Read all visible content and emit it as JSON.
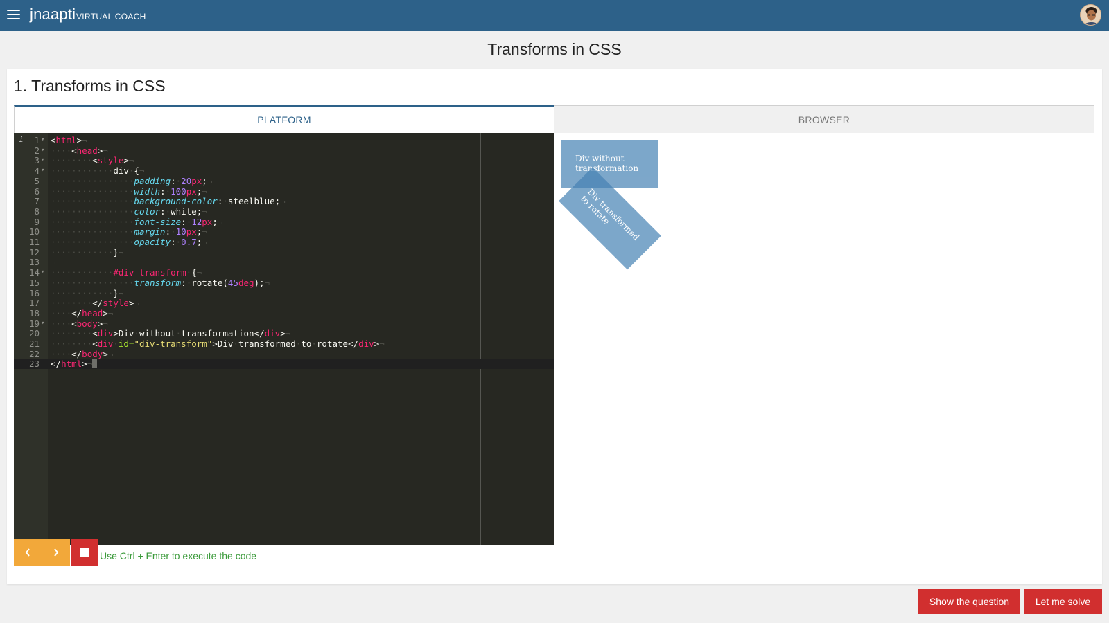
{
  "header": {
    "menu_icon": "hamburger-icon",
    "brand": "jnaapti",
    "brand_sub": "VIRTUAL COACH",
    "avatar_icon": "user-avatar"
  },
  "page_title": "Transforms in CSS",
  "card": {
    "title": "1. Transforms in CSS",
    "tabs": [
      {
        "label": "PLATFORM",
        "active": true
      },
      {
        "label": "BROWSER",
        "active": false
      }
    ]
  },
  "editor": {
    "lines": [
      "<html>",
      "    <head>",
      "        <style>",
      "            div {",
      "                padding: 20px;",
      "                width: 100px;",
      "                background-color: steelblue;",
      "                color: white;",
      "                font-size: 12px;",
      "                margin: 10px;",
      "                opacity: 0.7;",
      "            }",
      "",
      "            #div-transform {",
      "                transform: rotate(45deg);",
      "            }",
      "        </style>",
      "    </head>",
      "    <body>",
      "        <div>Div without transformation</div>",
      "        <div id=\"div-transform\">Div transformed to rotate</div>",
      "    </body>",
      "</html>"
    ],
    "folded_lines": [
      1,
      2,
      3,
      4,
      14,
      19
    ],
    "active_line": 23
  },
  "browser_output": {
    "div1_text": "Div without transformation",
    "div2_text": "Div transformed to rotate"
  },
  "controls": {
    "prev_icon": "chevron-left-icon",
    "next_icon": "chevron-right-icon",
    "stop_icon": "stop-icon",
    "hint": "Use Ctrl + Enter to execute the code"
  },
  "actions": {
    "show_question": "Show the question",
    "let_me_solve": "Let me solve"
  },
  "colors": {
    "header": "#2d6189",
    "accent_orange": "#f2a83a",
    "accent_red": "#d12f2f",
    "hint_green": "#3a9a3a"
  }
}
